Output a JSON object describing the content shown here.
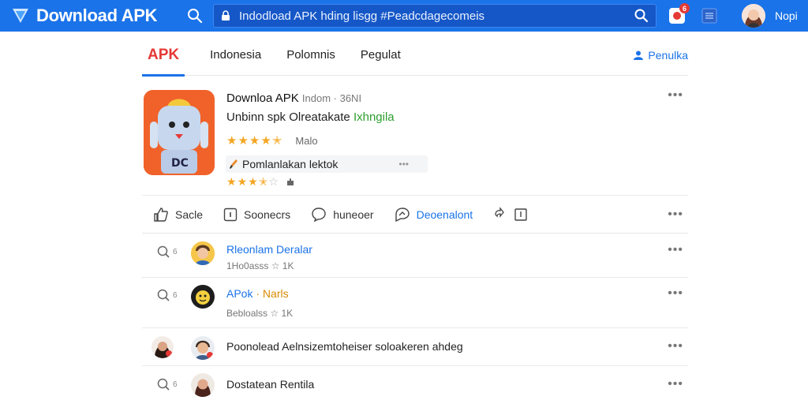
{
  "header": {
    "brand": "Download APK",
    "search_value": "Indodload APK hding lisgg #Peadcdagecomeis",
    "notif_count": "6",
    "user_name": "Nopi"
  },
  "nav": {
    "tabs": [
      {
        "label": "APK",
        "active": true
      },
      {
        "label": "Indonesia"
      },
      {
        "label": "Polomnis"
      },
      {
        "label": "Pegulat"
      }
    ],
    "right_link": "Penulka"
  },
  "app": {
    "title": "Downloa APK",
    "title_extra": "Indom · 36NI",
    "subtitle": "Unbinn spk Olreatakate",
    "subtitle_highlight": "Ixhngila",
    "rating1_label": "Malo",
    "rating1": 4.5,
    "pill_text": "Pomlanlakan lektok",
    "pill_dots": "•••",
    "rating2": 3.5,
    "more": "•••"
  },
  "actions": [
    {
      "label": "Sacle",
      "icon": "thumbs-up-icon"
    },
    {
      "label": "Soonecrs",
      "icon": "info-box-icon"
    },
    {
      "label": "huneoer",
      "icon": "comment-icon"
    },
    {
      "label": "Deoenalont",
      "icon": "share-icon",
      "accent": true
    },
    {
      "label": "",
      "icon": "react-icon"
    }
  ],
  "actions_more": "•••",
  "rows": [
    {
      "lead_count": "6",
      "name": "Rleonlam Deralar",
      "name_color": "blue",
      "meta": "1Ho0asss ☆ 1K",
      "more": "•••"
    },
    {
      "lead_count": "6",
      "name": "APok",
      "name_sep": " · ",
      "name_extra": "Narls",
      "meta": "Bebloalss ☆ 1K",
      "more": "•••"
    },
    {
      "name": "Poonolead Aelnsizemtoheiser soloakeren ahdeg",
      "highlight": "Aelnsizem",
      "more": "•••"
    },
    {
      "lead_count": "6",
      "name": "Dostatean Rentila",
      "more": "•••"
    }
  ],
  "colors": {
    "primary": "#1a73e8",
    "brand_red": "#e53935",
    "star": "#f4a623",
    "highlight_green": "#2e9e2e"
  }
}
